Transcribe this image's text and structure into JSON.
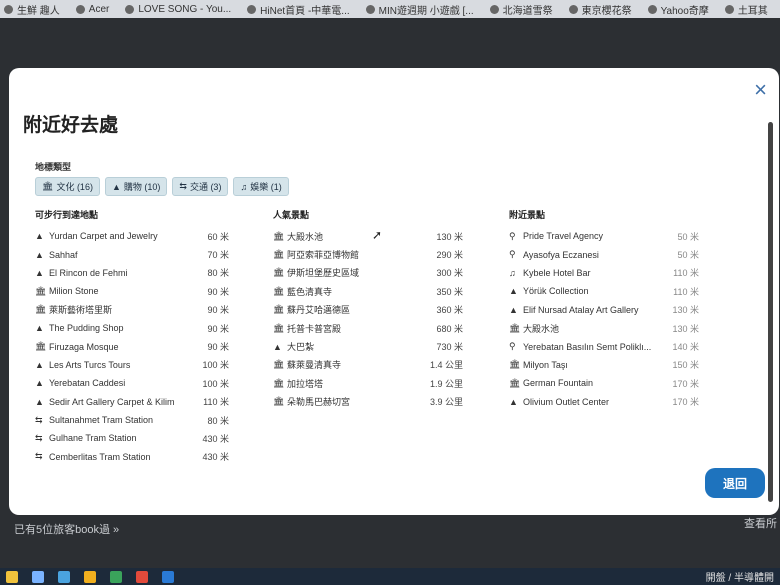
{
  "bookmarks": [
    "生鮮 趣人",
    "Acer",
    "LOVE SONG - You...",
    "HiNet首頁 -中華電...",
    "MIN遊週期 小遊戲 [...",
    "北海道雪祭",
    "東京櫻花祭",
    "Yahoo奇摩",
    "土耳其"
  ],
  "modal": {
    "title": "附近好去處",
    "close_icon": "×",
    "filter_title": "地標類型",
    "chips": [
      {
        "icon": "museum-icon",
        "glyph": "🏛",
        "label": "文化 (16)"
      },
      {
        "icon": "shopping-bag-icon",
        "glyph": "▲",
        "label": "購物 (10)"
      },
      {
        "icon": "transit-icon",
        "glyph": "⇆",
        "label": "交通 (3)"
      },
      {
        "icon": "entertainment-icon",
        "glyph": "♫",
        "label": "娛樂 (1)"
      }
    ],
    "walkable": {
      "title": "可步行到達地點",
      "items": [
        {
          "icon": "shopping-bag-icon",
          "glyph": "▲",
          "name": "Yurdan Carpet and Jewelry",
          "dist": "60 米"
        },
        {
          "icon": "shopping-bag-icon",
          "glyph": "▲",
          "name": "Sahhaf",
          "dist": "70 米"
        },
        {
          "icon": "shopping-bag-icon",
          "glyph": "▲",
          "name": "El Rincon de Fehmi",
          "dist": "80 米"
        },
        {
          "icon": "museum-icon",
          "glyph": "🏛",
          "name": "Milion Stone",
          "dist": "90 米"
        },
        {
          "icon": "museum-icon",
          "glyph": "🏛",
          "name": "萊斯藝術塔里斯",
          "dist": "90 米"
        },
        {
          "icon": "shopping-bag-icon",
          "glyph": "▲",
          "name": "The Pudding Shop",
          "dist": "90 米"
        },
        {
          "icon": "museum-icon",
          "glyph": "🏛",
          "name": "Firuzaga Mosque",
          "dist": "90 米"
        },
        {
          "icon": "shopping-bag-icon",
          "glyph": "▲",
          "name": "Les Arts Turcs Tours",
          "dist": "100 米"
        },
        {
          "icon": "shopping-bag-icon",
          "glyph": "▲",
          "name": "Yerebatan Caddesi",
          "dist": "100 米"
        },
        {
          "icon": "shopping-bag-icon",
          "glyph": "▲",
          "name": "Sedir Art Gallery Carpet & Kilim",
          "dist": "110 米"
        },
        {
          "icon": "transit-icon",
          "glyph": "⇆",
          "name": "Sultanahmet Tram Station",
          "dist": "80 米"
        },
        {
          "icon": "transit-icon",
          "glyph": "⇆",
          "name": "Gulhane Tram Station",
          "dist": "430 米"
        },
        {
          "icon": "transit-icon",
          "glyph": "⇆",
          "name": "Cemberlitas Tram Station",
          "dist": "430 米"
        }
      ]
    },
    "popular": {
      "title": "人氣景點",
      "items": [
        {
          "icon": "museum-icon",
          "glyph": "🏛",
          "name": "大殿水池",
          "dist": "130 米"
        },
        {
          "icon": "museum-icon",
          "glyph": "🏛",
          "name": "阿亞索菲亞博物館",
          "dist": "290 米"
        },
        {
          "icon": "museum-icon",
          "glyph": "🏛",
          "name": "伊斯坦堡歷史區域",
          "dist": "300 米"
        },
        {
          "icon": "museum-icon",
          "glyph": "🏛",
          "name": "藍色清真寺",
          "dist": "350 米"
        },
        {
          "icon": "museum-icon",
          "glyph": "🏛",
          "name": "蘇丹艾哈邁德區",
          "dist": "360 米"
        },
        {
          "icon": "museum-icon",
          "glyph": "🏛",
          "name": "托普卡普宮殿",
          "dist": "680 米"
        },
        {
          "icon": "shopping-bag-icon",
          "glyph": "▲",
          "name": "大巴紮",
          "dist": "730 米"
        },
        {
          "icon": "museum-icon",
          "glyph": "🏛",
          "name": "蘇萊曼清真寺",
          "dist": "1.4 公里"
        },
        {
          "icon": "museum-icon",
          "glyph": "🏛",
          "name": "加拉塔塔",
          "dist": "1.9 公里"
        },
        {
          "icon": "museum-icon",
          "glyph": "🏛",
          "name": "朵勒馬巴赫切宮",
          "dist": "3.9 公里"
        }
      ]
    },
    "nearby": {
      "title": "附近景點",
      "items": [
        {
          "icon": "location-pin-icon",
          "glyph": "⚲",
          "name": "Pride Travel Agency",
          "dist": "50 米"
        },
        {
          "icon": "location-pin-icon",
          "glyph": "⚲",
          "name": "Ayasofya Eczanesi",
          "dist": "50 米"
        },
        {
          "icon": "entertainment-icon",
          "glyph": "♫",
          "name": "Kybele Hotel Bar",
          "dist": "110 米"
        },
        {
          "icon": "shopping-bag-icon",
          "glyph": "▲",
          "name": "Yörük Collection",
          "dist": "110 米"
        },
        {
          "icon": "shopping-bag-icon",
          "glyph": "▲",
          "name": "Elif Nursad Atalay Art Gallery",
          "dist": "130 米"
        },
        {
          "icon": "museum-icon",
          "glyph": "🏛",
          "name": "大殿水池",
          "dist": "130 米"
        },
        {
          "icon": "location-pin-icon",
          "glyph": "⚲",
          "name": "Yerebatan Basılın Semt Poliklı...",
          "dist": "140 米"
        },
        {
          "icon": "museum-icon",
          "glyph": "🏛",
          "name": "Milyon Taşı",
          "dist": "150 米"
        },
        {
          "icon": "museum-icon",
          "glyph": "🏛",
          "name": "German Fountain",
          "dist": "170 米"
        },
        {
          "icon": "shopping-bag-icon",
          "glyph": "▲",
          "name": "Olivium Outlet Center",
          "dist": "170 米"
        }
      ]
    },
    "back_button": "退回"
  },
  "behind": {
    "left_text": "已有5位旅客book過 »",
    "right_text": "查看所",
    "taskbar_text": "開盤 / 半導體開"
  },
  "colors": {
    "accent": "#1e73be",
    "chip_bg": "#d5e4ea"
  }
}
